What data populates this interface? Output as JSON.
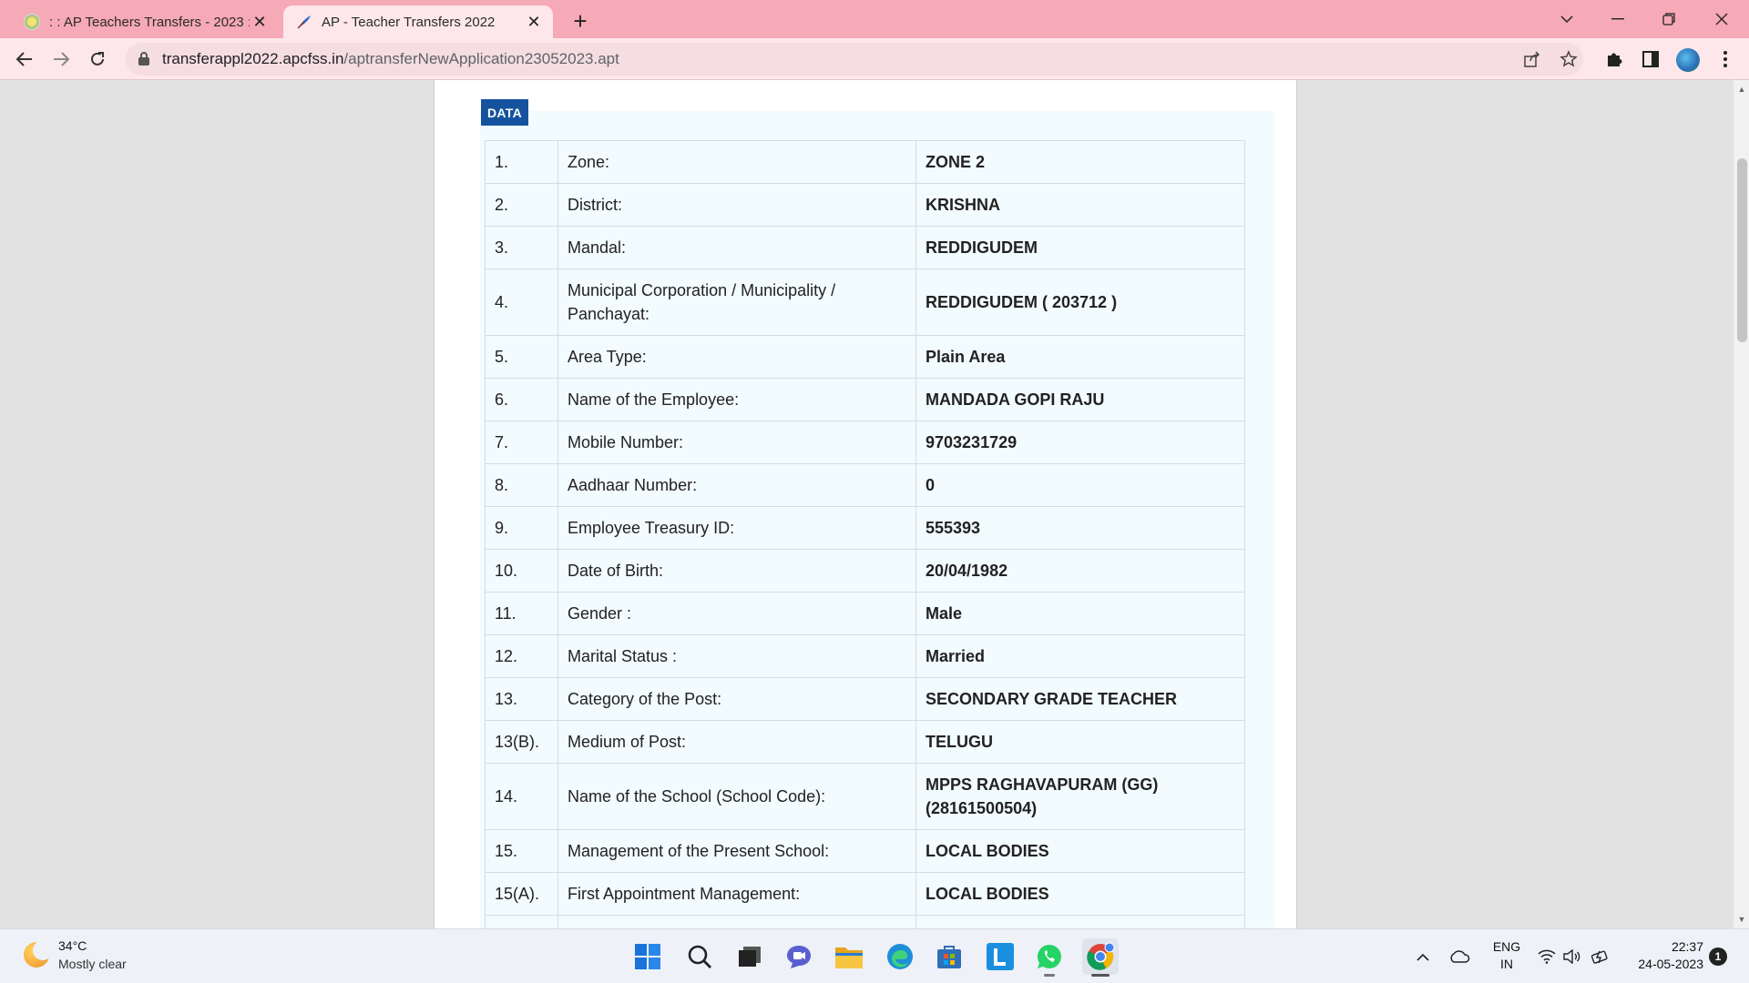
{
  "browser": {
    "tabs": [
      {
        "title": ": : AP Teachers Transfers - 2023 : :",
        "active": false
      },
      {
        "title": "AP - Teacher Transfers 2022",
        "active": true
      }
    ],
    "new_tab": "+",
    "url_domain": "transferappl2022.apcfss.in",
    "url_path": "/aptransferNewApplication23052023.apt"
  },
  "page": {
    "section_badge": "DATA",
    "rows": [
      {
        "no": "1.",
        "label": "Zone:",
        "value": "ZONE 2"
      },
      {
        "no": "2.",
        "label": "District:",
        "value": "KRISHNA"
      },
      {
        "no": "3.",
        "label": "Mandal:",
        "value": "REDDIGUDEM"
      },
      {
        "no": "4.",
        "label": "Municipal Corporation / Municipality / Panchayat:",
        "value": "REDDIGUDEM ( 203712 )"
      },
      {
        "no": "5.",
        "label": "Area Type:",
        "value": "Plain Area"
      },
      {
        "no": "6.",
        "label": "Name of the Employee:",
        "value": "MANDADA GOPI RAJU"
      },
      {
        "no": "7.",
        "label": "Mobile Number:",
        "value": "9703231729"
      },
      {
        "no": "8.",
        "label": "Aadhaar Number:",
        "value": "0"
      },
      {
        "no": "9.",
        "label": "Employee Treasury ID:",
        "value": "555393"
      },
      {
        "no": "10.",
        "label": "Date of Birth:",
        "value": "20/04/1982"
      },
      {
        "no": "11.",
        "label": "Gender :",
        "value": "Male"
      },
      {
        "no": "12.",
        "label": "Marital Status :",
        "value": "Married"
      },
      {
        "no": "13.",
        "label": "Category of the Post:",
        "value": "SECONDARY GRADE TEACHER"
      },
      {
        "no": "13(B).",
        "label": "Medium of Post:",
        "value": "TELUGU"
      },
      {
        "no": "14.",
        "label": "Name of the School (School Code):",
        "value": "MPPS RAGHAVAPURAM (GG) (28161500504)"
      },
      {
        "no": "15.",
        "label": "Management of the Present School:",
        "value": "LOCAL BODIES"
      },
      {
        "no": "15(A).",
        "label": "First Appointment Management:",
        "value": "LOCAL BODIES"
      },
      {
        "no": "",
        "label": "",
        "value": ""
      }
    ]
  },
  "taskbar": {
    "weather_temp": "34°C",
    "weather_desc": "Mostly clear",
    "lang_line1": "ENG",
    "lang_line2": "IN",
    "time": "22:37",
    "date": "24-05-2023",
    "notification_count": "1"
  },
  "colors": {
    "tabstrip": "#f6a9b6",
    "toolbar": "#fde7eb",
    "badge": "#15539e",
    "panel": "#f2fbfd"
  }
}
